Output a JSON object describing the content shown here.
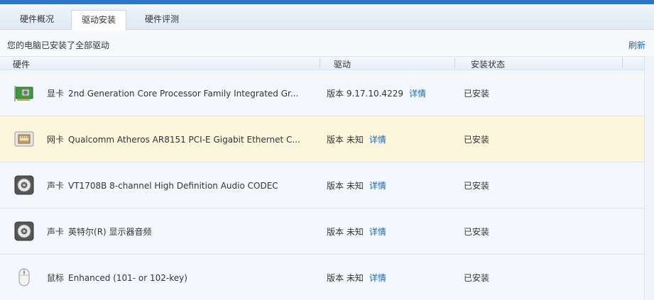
{
  "tabs": [
    {
      "label": "硬件概况",
      "active": false
    },
    {
      "label": "驱动安装",
      "active": true
    },
    {
      "label": "硬件评测",
      "active": false
    }
  ],
  "info": {
    "message": "您的电脑已安装了全部驱动",
    "refresh_label": "刷新"
  },
  "columns": {
    "hardware": "硬件",
    "driver": "驱动",
    "status": "安装状态"
  },
  "rows": [
    {
      "icon": "graphics-card-icon",
      "category": "显卡",
      "name": "2nd Generation Core Processor Family Integrated Gr...",
      "version": "版本 9.17.10.4229",
      "detail": "详情",
      "status": "已安装",
      "highlight": false
    },
    {
      "icon": "network-card-icon",
      "category": "网卡",
      "name": "Qualcomm Atheros AR8151 PCI-E Gigabit Ethernet C...",
      "version": "版本 未知",
      "detail": "详情",
      "status": "已安装",
      "highlight": true
    },
    {
      "icon": "speaker-icon",
      "category": "声卡",
      "name": "VT1708B 8-channel High Definition Audio CODEC",
      "version": "版本 未知",
      "detail": "详情",
      "status": "已安装",
      "highlight": false
    },
    {
      "icon": "speaker-icon",
      "category": "声卡",
      "name": "英特尔(R) 显示器音频",
      "version": "版本 未知",
      "detail": "详情",
      "status": "已安装",
      "highlight": false
    },
    {
      "icon": "mouse-icon",
      "category": "鼠标",
      "name": "Enhanced (101- or 102-key)",
      "version": "版本 未知",
      "detail": "详情",
      "status": "已安装",
      "highlight": false
    }
  ],
  "colors": {
    "accent": "#2a76c8",
    "link": "#1a66c2",
    "highlight_row": "#fdf6dc"
  }
}
